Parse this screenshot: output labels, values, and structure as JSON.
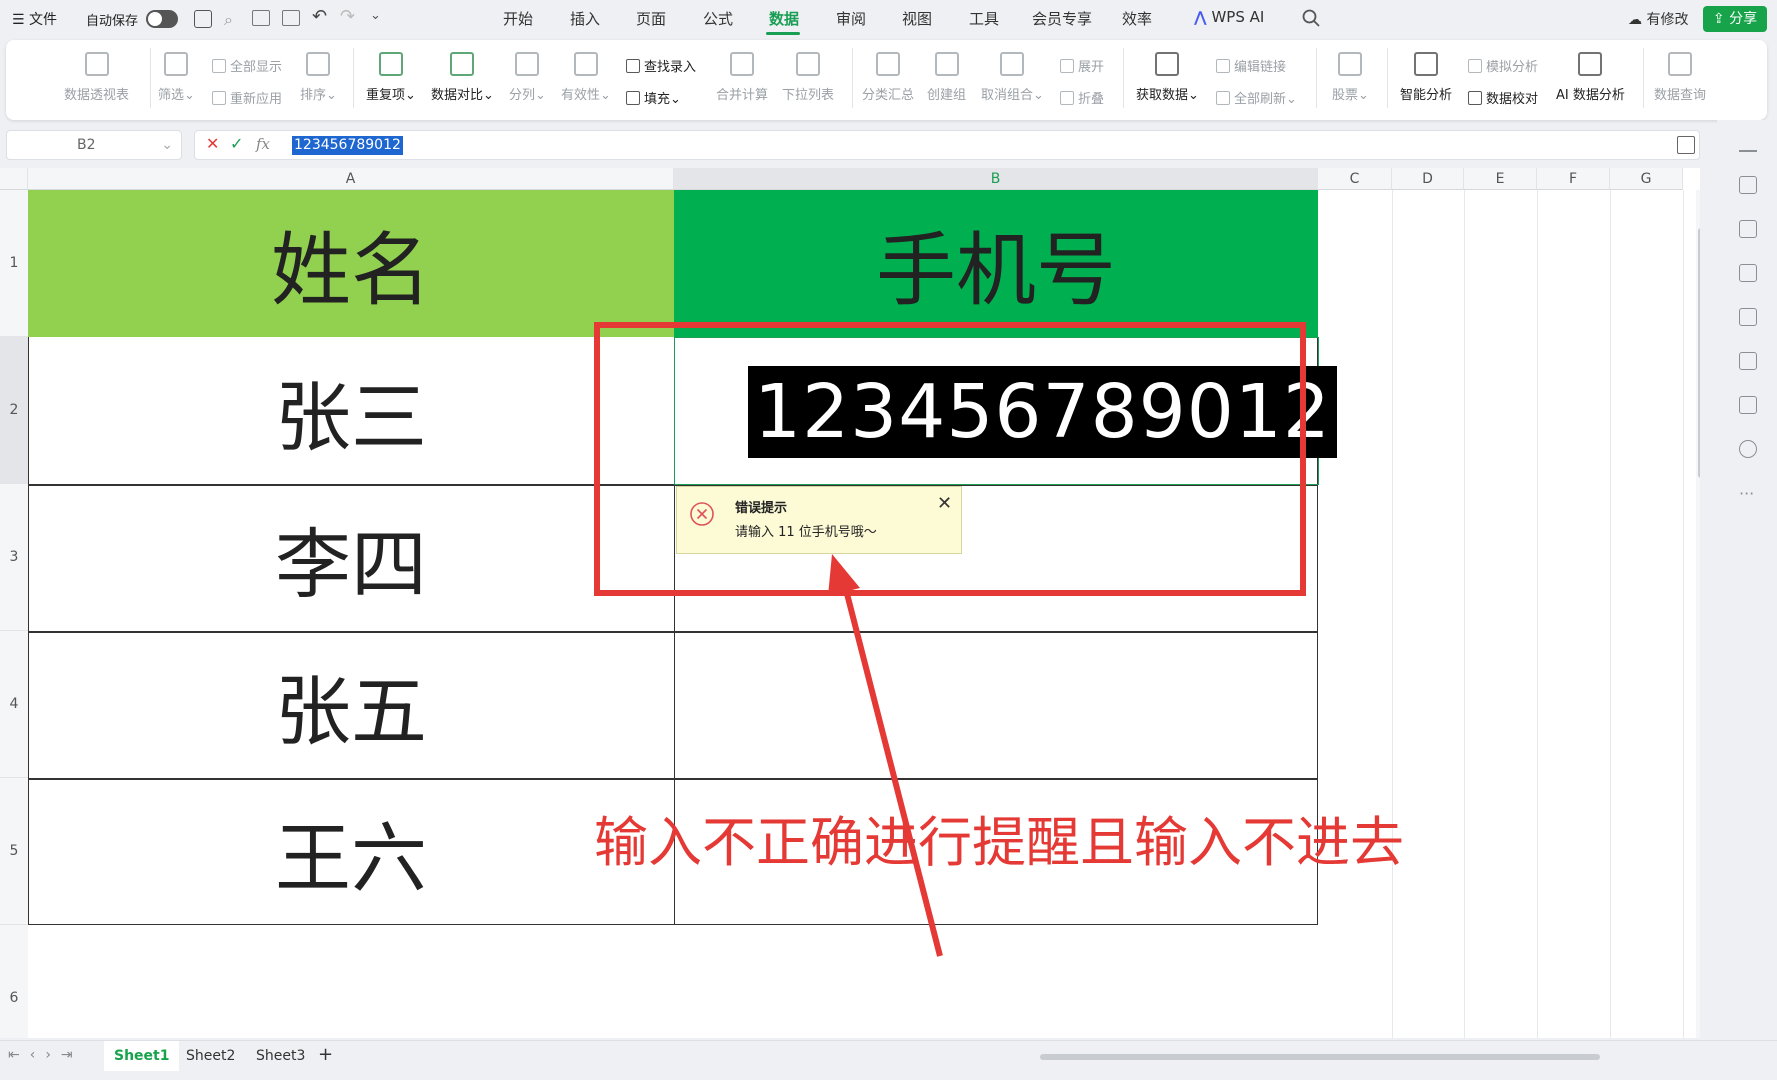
{
  "topbar": {
    "file_menu": "文件",
    "autosave_label": "自动保存",
    "menu_tabs": [
      "开始",
      "插入",
      "页面",
      "公式",
      "数据",
      "审阅",
      "视图",
      "工具",
      "会员专享",
      "效率"
    ],
    "active_tab": "数据",
    "wps_ai": "WPS AI",
    "edit_status": "有修改",
    "share_label": "分享"
  },
  "ribbon": {
    "pivot": "数据透视表",
    "filter": "筛选",
    "show_all": "全部显示",
    "reapply": "重新应用",
    "sort": "排序",
    "duplicates": "重复项",
    "compare": "数据对比",
    "split": "分列",
    "validity": "有效性",
    "find_entry": "查找录入",
    "fill": "填充",
    "consolidate": "合并计算",
    "dropdown_list": "下拉列表",
    "subtotal": "分类汇总",
    "create_group": "创建组",
    "ungroup": "取消组合",
    "expand": "展开",
    "collapse": "折叠",
    "get_data": "获取数据",
    "edit_links": "编辑链接",
    "refresh_all": "全部刷新",
    "stocks": "股票",
    "smart_analysis": "智能分析",
    "what_if": "模拟分析",
    "data_check": "数据校对",
    "ai_analysis": "AI 数据分析",
    "data_query": "数据查询"
  },
  "formula_bar": {
    "name_box": "B2",
    "fx": "fx",
    "value": "123456789012"
  },
  "sheet": {
    "columns": [
      "A",
      "B",
      "C",
      "D",
      "E",
      "F",
      "G"
    ],
    "selected_column": "B",
    "rows": [
      "1",
      "2",
      "3",
      "4",
      "5",
      "6"
    ],
    "selected_row": "2",
    "header_name": "姓名",
    "header_phone": "手机号",
    "names": [
      "张三",
      "李四",
      "张五",
      "王六"
    ],
    "phone_input": "123456789012",
    "header_a_color": "#92d050",
    "header_b_color": "#00b050"
  },
  "error_popup": {
    "title": "错误提示",
    "message": "请输入 11 位手机号哦～"
  },
  "annotation": {
    "text": "输入不正确进行提醒且输入不进去",
    "color": "#e53935"
  },
  "sheet_tabs": [
    "Sheet1",
    "Sheet2",
    "Sheet3"
  ],
  "active_sheet": "Sheet1"
}
